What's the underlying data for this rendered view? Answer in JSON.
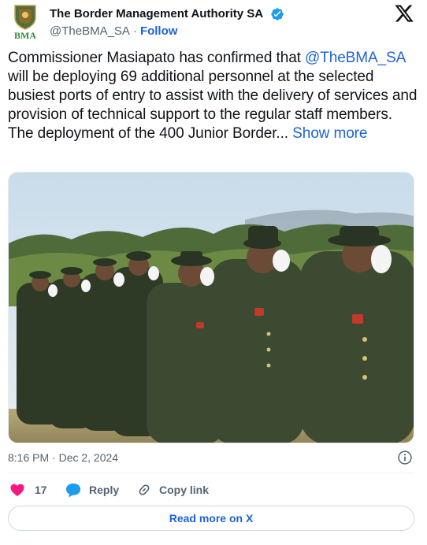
{
  "author": {
    "name": "The Border Management Authority SA",
    "handle": "@TheBMA_SA",
    "separator": "·",
    "follow_label": "Follow",
    "avatar_text": "BMA",
    "verified": true
  },
  "tweet": {
    "text_before": "Commissioner Masiapato has confirmed that ",
    "mention": "@TheBMA_SA",
    "text_after": " will be deploying 69 additional personnel at the selected busiest ports of entry to assist with the delivery of services and provision of technical support to the regular staff members. The deployment of the 400 Junior Border... ",
    "show_more_label": "Show more",
    "timestamp": "8:16 PM · Dec 2, 2024"
  },
  "actions": {
    "like_count": "17",
    "reply_label": "Reply",
    "copy_label": "Copy link",
    "read_more_label": "Read more on X"
  },
  "icons": {
    "like": "heart-icon",
    "reply": "speech-bubble-icon",
    "copy": "link-icon",
    "info": "info-icon",
    "brand": "x-logo-icon",
    "verified": "verified-badge-icon"
  },
  "colors": {
    "link": "#1d64d8",
    "like": "#f91880",
    "reply": "#1d9bf0",
    "muted": "#536471",
    "text": "#0f1419"
  }
}
